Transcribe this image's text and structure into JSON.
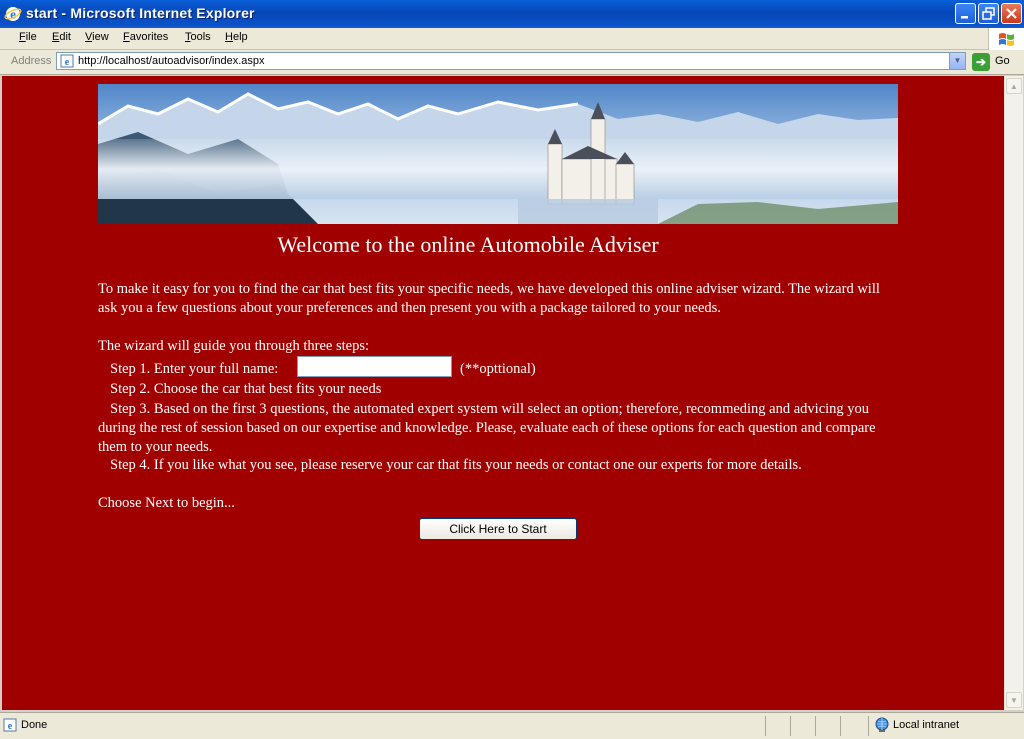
{
  "window": {
    "title": "start - Microsoft Internet Explorer"
  },
  "menu": [
    {
      "label": "File"
    },
    {
      "label": "Edit"
    },
    {
      "label": "View"
    },
    {
      "label": "Favorites"
    },
    {
      "label": "Tools"
    },
    {
      "label": "Help"
    }
  ],
  "addressbar": {
    "label": "Address",
    "url": "http://localhost/autoadvisor/index.aspx",
    "go_label": "Go"
  },
  "page": {
    "title": "Welcome to the online Automobile Adviser",
    "intro": "To make it easy for you to find the car that best fits your specific needs, we have developed this online adviser wizard. The wizard will ask you a few questions about your preferences and then present you with a package tailored to your needs.",
    "guide": "The wizard will guide you through three steps:",
    "step1": "Step 1.  Enter your full name:",
    "name_value": "",
    "optional": "(**opttional)",
    "step2": "Step 2.  Choose the car that best fits your needs",
    "step3": "Step 3.  Based on the first 3 questions, the automated expert system will select an option; therefore, recommeding and advicing you during the rest of session based on our expertise and knowledge. Please, evaluate each of these options for each question and compare them to your needs.",
    "step4": "Step 4.  If you like what you see, please reserve your  car that fits your needs or contact one our experts for more details.",
    "choose": "Choose Next to begin...",
    "start_button": "Click Here to Start"
  },
  "status": {
    "text": "Done",
    "zone": "Local intranet"
  },
  "colors": {
    "page_background": "#a10000",
    "title_bar": "#0a52c9",
    "chrome": "#ece9d8"
  }
}
